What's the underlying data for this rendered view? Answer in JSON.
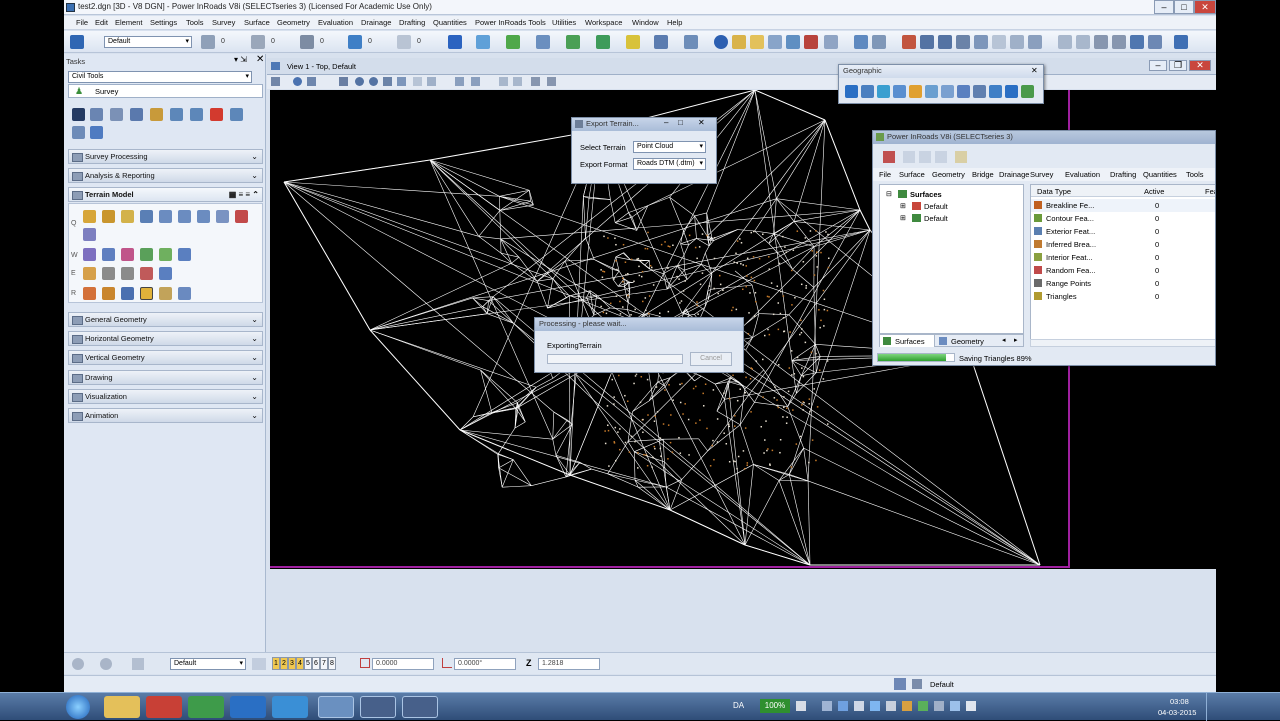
{
  "window": {
    "title": "test2.dgn [3D - V8 DGN] - Power InRoads V8i (SELECTseries 3) (Licensed For Academic Use Only)"
  },
  "menu": [
    "File",
    "Edit",
    "Element",
    "Settings",
    "Tools",
    "Survey",
    "Surface",
    "Geometry",
    "Evaluation",
    "Drainage",
    "Drafting",
    "Quantities",
    "Power InRoads Tools",
    "Utilities",
    "Workspace",
    "Window",
    "Help"
  ],
  "toolbar": {
    "level_combo": "Default",
    "counts": [
      "0",
      "0",
      "0",
      "0",
      "0",
      "0"
    ]
  },
  "tasks": {
    "title": "Tasks",
    "combo": "Civil Tools",
    "survey_item": "Survey",
    "sections_top": [
      "Survey Processing",
      "Analysis & Reporting"
    ],
    "terrain_model": "Terrain Model",
    "row_letters": [
      "Q",
      "W",
      "E",
      "R"
    ],
    "sections_bottom": [
      "General Geometry",
      "Horizontal Geometry",
      "Vertical Geometry",
      "Drawing",
      "Visualization",
      "Animation"
    ]
  },
  "view": {
    "title": "View 1 - Top, Default"
  },
  "export_dialog": {
    "title": "Export Terrain...",
    "select_terrain_label": "Select Terrain",
    "select_terrain_value": "Point Cloud",
    "export_format_label": "Export Format",
    "export_format_value": "Roads DTM (.dtm)"
  },
  "processing_dialog": {
    "title": "Processing - please wait...",
    "message": "ExportingTerrain",
    "cancel": "Cancel"
  },
  "geographic": {
    "title": "Geographic"
  },
  "inroads": {
    "title": "Power InRoads V8i (SELECTseries 3)",
    "menu": [
      "File",
      "Surface",
      "Geometry",
      "Bridge",
      "Drainage",
      "Survey",
      "Evaluation",
      "Drafting",
      "Quantities",
      "Tools"
    ],
    "tree": {
      "root": "Surfaces",
      "children": [
        "Default",
        "Default"
      ]
    },
    "columns": [
      "Data Type",
      "Active",
      "Fea"
    ],
    "rows": [
      {
        "type": "Breakline Fe...",
        "active": "0"
      },
      {
        "type": "Contour Fea...",
        "active": "0"
      },
      {
        "type": "Exterior Feat...",
        "active": "0"
      },
      {
        "type": "Inferred Brea...",
        "active": "0"
      },
      {
        "type": "Interior Feat...",
        "active": "0"
      },
      {
        "type": "Random Fea...",
        "active": "0"
      },
      {
        "type": "Range Points",
        "active": "0"
      },
      {
        "type": "Triangles",
        "active": "0"
      }
    ],
    "tabs": [
      "Surfaces",
      "Geometry"
    ],
    "status": "Saving Triangles  89%",
    "progress": 0.89
  },
  "bottom": {
    "level": "Default",
    "view_numbers": [
      "1",
      "2",
      "3",
      "4",
      "5",
      "6",
      "7",
      "8"
    ],
    "x_value": "0.0000",
    "angle_value": "0.0000°",
    "z_label": "Z",
    "z_value": "1.2818",
    "status_level": "Default"
  },
  "taskbar": {
    "lang": "DA",
    "zoom": "100%",
    "time": "03:08",
    "date": "04-03-2015"
  },
  "colors": {
    "accent": "#3a6fb2",
    "border_magenta": "#a020a0",
    "mesh": "#ffffff",
    "terrain": "#c67a2a"
  }
}
